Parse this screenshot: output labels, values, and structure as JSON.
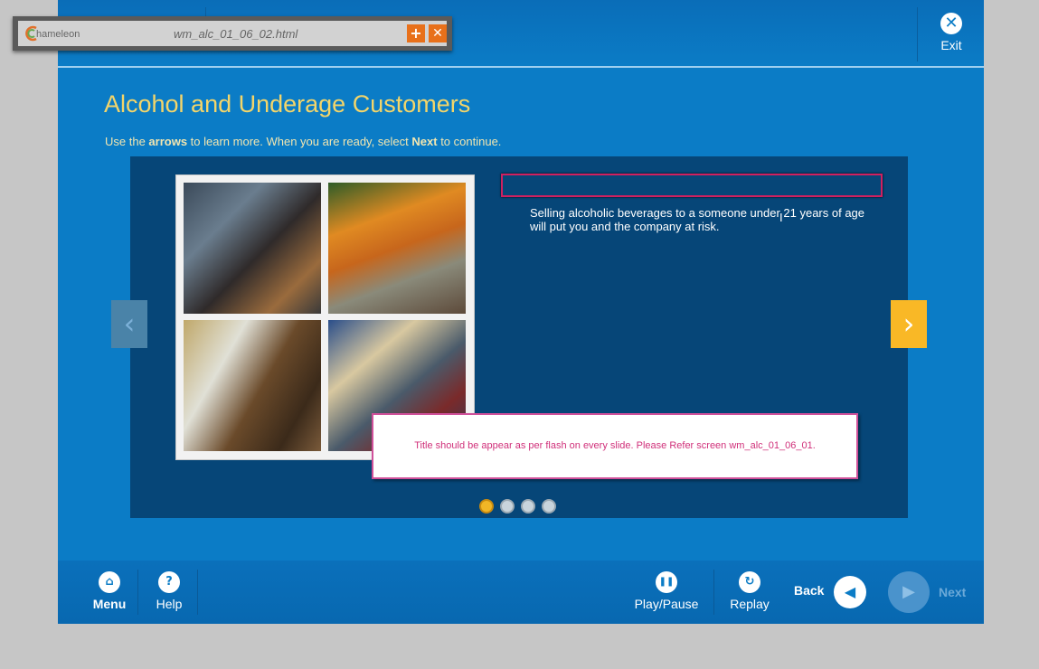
{
  "topbar": {
    "exit_label": "Exit",
    "exit_icon": "✕"
  },
  "toolwindow": {
    "brand": "hameleon",
    "filename": "wm_alc_01_06_02.html",
    "add_icon": "+",
    "close_icon": "✕"
  },
  "page": {
    "title": "Alcohol and Underage Customers",
    "instructions": {
      "part1": "Use the ",
      "arrows": "arrows",
      "part2": " to learn more.  When you are ready, select ",
      "next": "Next",
      "part3": " to continue."
    }
  },
  "slide": {
    "body_text": "Selling alcoholic beverages to a someone under 21 years of age will put you and the company at risk.",
    "review_note": "Title should be appear as per flash on every slide. Please Refer screen wm_alc_01_06_01.",
    "dots_total": 4,
    "active_dot": 1
  },
  "nav": {
    "prev_icon": "‹",
    "next_icon": "›"
  },
  "bottombar": {
    "menu_label": "Menu",
    "help_label": "Help",
    "playpause_label": "Play/Pause",
    "replay_label": "Replay",
    "back_label": "Back",
    "next_label": "Next",
    "menu_icon": "⌂",
    "help_icon": "?",
    "play_icon": "❚❚",
    "replay_icon": "↻",
    "back_icon": "◀",
    "next_icon": "▶"
  },
  "colors": {
    "accent": "#f3d56a",
    "stage": "#0b7cc6",
    "panel": "#064678",
    "arrow_active": "#f9b826",
    "note_border": "#d0509a"
  }
}
